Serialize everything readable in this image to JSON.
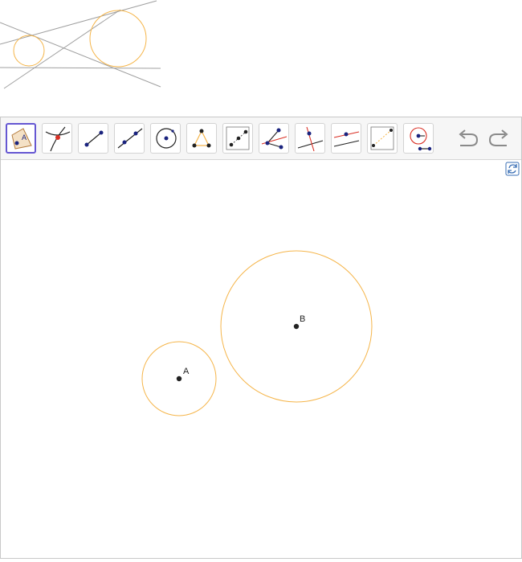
{
  "toolbar": {
    "tools": [
      {
        "name": "move",
        "icon": "move-polygon-icon"
      },
      {
        "name": "point",
        "icon": "intersect-point-icon"
      },
      {
        "name": "segment",
        "icon": "segment-icon"
      },
      {
        "name": "line",
        "icon": "line-icon"
      },
      {
        "name": "circle",
        "icon": "circle-center-icon"
      },
      {
        "name": "polygon",
        "icon": "triangle-icon"
      },
      {
        "name": "midpoint",
        "icon": "midpoint-icon"
      },
      {
        "name": "angle-bisector",
        "icon": "angle-bisector-icon"
      },
      {
        "name": "perpendicular",
        "icon": "perpendicular-line-icon"
      },
      {
        "name": "parallel",
        "icon": "parallel-line-icon"
      },
      {
        "name": "reflect",
        "icon": "reflect-icon"
      },
      {
        "name": "compass",
        "icon": "compass-icon"
      }
    ],
    "active_tool": "move",
    "undo_icon": "undo-icon",
    "redo_icon": "redo-icon"
  },
  "graphics": {
    "refresh_icon": "refresh-icon",
    "points": [
      {
        "label": "A",
        "color": "#222222"
      },
      {
        "label": "B",
        "color": "#222222"
      }
    ],
    "circle_color": "#f5b54a"
  },
  "colors": {
    "accent": "#6557d2",
    "point": "#00008b",
    "highlight": "#d93025",
    "circle": "#f5b54a",
    "preview_line": "#9a9a9a"
  }
}
